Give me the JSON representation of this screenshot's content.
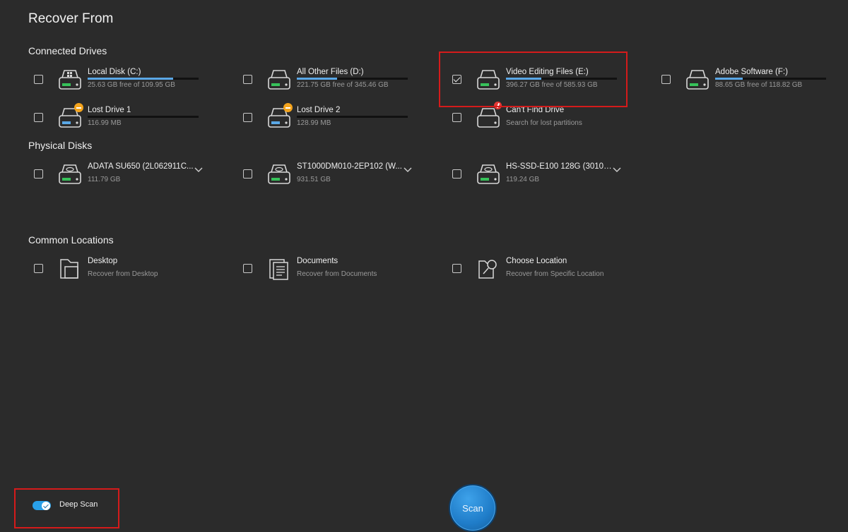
{
  "title": "Recover From",
  "sections": {
    "connected": "Connected Drives",
    "physical": "Physical Disks",
    "common": "Common Locations"
  },
  "connected_drives": [
    {
      "name": "Local Disk (C:)",
      "sub": "25.63 GB free of 109.95 GB",
      "used_fraction": 0.77,
      "checked": false,
      "icon": "windows-drive-icon"
    },
    {
      "name": "All Other Files (D:)",
      "sub": "221.75 GB free of 345.46 GB",
      "used_fraction": 0.36,
      "checked": false,
      "icon": "drive-icon"
    },
    {
      "name": "Video Editing Files (E:)",
      "sub": "396.27 GB free of 585.93 GB",
      "used_fraction": 0.32,
      "checked": true,
      "icon": "drive-icon"
    },
    {
      "name": "Adobe Software (F:)",
      "sub": "88.65 GB free of 118.82 GB",
      "used_fraction": 0.25,
      "checked": false,
      "icon": "drive-icon"
    },
    {
      "name": "Lost Drive 1",
      "sub": "116.99 MB",
      "used_fraction": 0.0,
      "checked": false,
      "icon": "lost-drive-icon"
    },
    {
      "name": "Lost Drive 2",
      "sub": "128.99 MB",
      "used_fraction": 0.0,
      "checked": false,
      "icon": "lost-drive-icon"
    },
    {
      "name": "Can't Find Drive",
      "sub": "Search for lost partitions",
      "checked": false,
      "icon": "missing-drive-icon"
    }
  ],
  "physical_disks": [
    {
      "name": "ADATA SU650 (2L062911C...",
      "sub": "111.79 GB",
      "checked": false,
      "icon": "physical-disk-icon"
    },
    {
      "name": "ST1000DM010-2EP102 (W...",
      "sub": "931.51 GB",
      "checked": false,
      "icon": "physical-disk-icon"
    },
    {
      "name": "HS-SSD-E100 128G (30104...",
      "sub": "119.24 GB",
      "checked": false,
      "icon": "physical-disk-icon"
    }
  ],
  "common_locations": [
    {
      "name": "Desktop",
      "sub": "Recover from Desktop",
      "checked": false,
      "icon": "desktop-folder-icon"
    },
    {
      "name": "Documents",
      "sub": "Recover from Documents",
      "checked": false,
      "icon": "documents-icon"
    },
    {
      "name": "Choose Location",
      "sub": "Recover from Specific Location",
      "checked": false,
      "icon": "choose-location-icon"
    }
  ],
  "footer": {
    "deep_scan_label": "Deep Scan",
    "deep_scan_on": true,
    "scan_label": "Scan"
  },
  "colors": {
    "background": "#2b2b2b",
    "accent": "#5aa7e6",
    "highlight": "#d51b1b",
    "warning_badge": "#f4a41c"
  }
}
